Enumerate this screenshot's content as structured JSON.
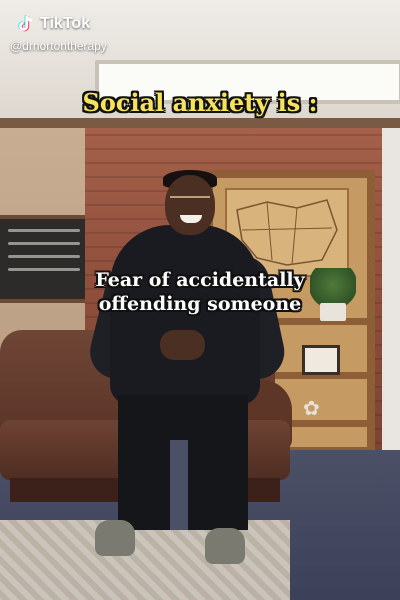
{
  "watermark": {
    "brand": "TikTok",
    "handle": "@drnortontherapy",
    "icon": "tiktok-logo-icon"
  },
  "overlay": {
    "headline": "Social anxiety is :",
    "caption_line1": "Fear of accidentally",
    "caption_line2": "offending someone"
  },
  "colors": {
    "headline_text": "#f6e35a",
    "caption_text": "#ffffff",
    "text_outline": "#111111"
  }
}
